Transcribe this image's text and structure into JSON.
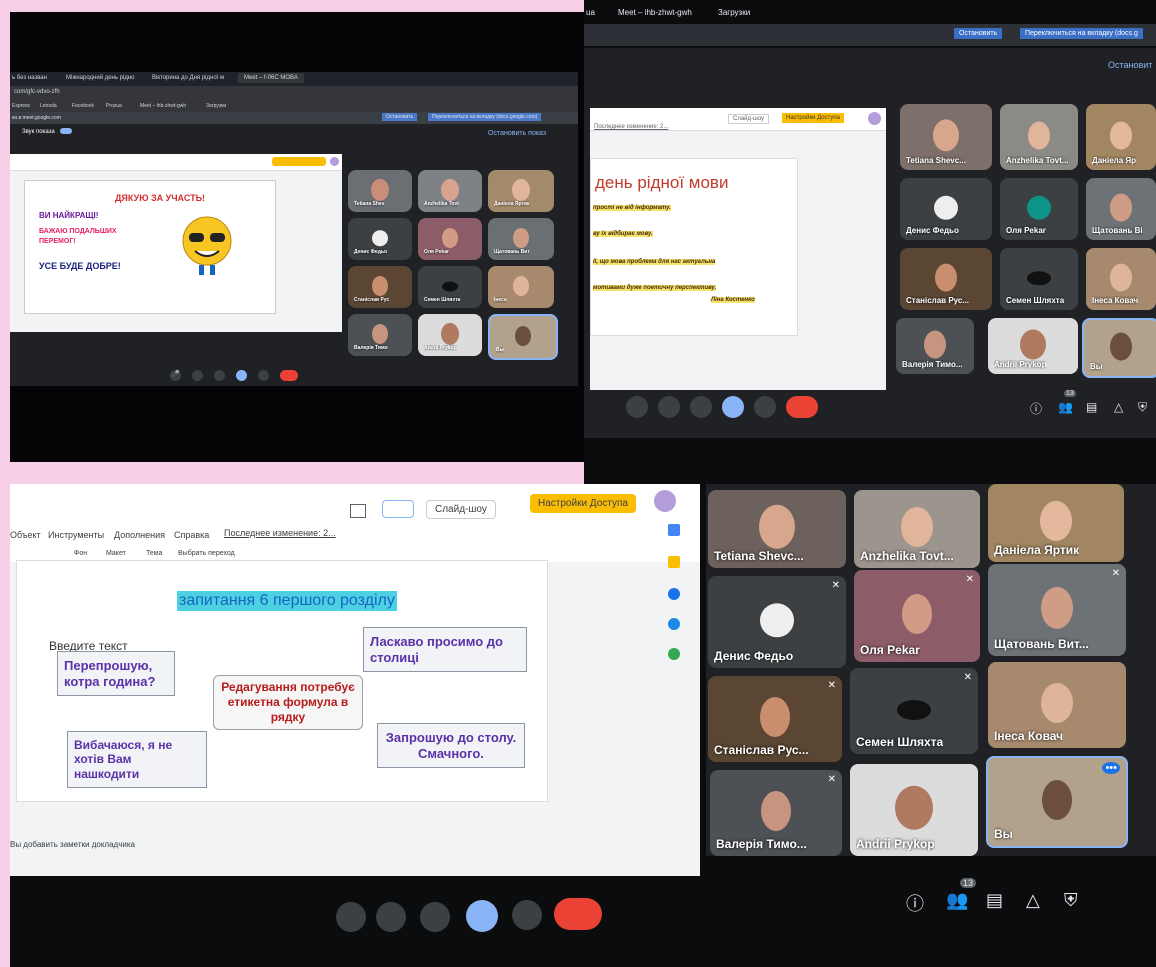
{
  "photo_tl": {
    "tabs": [
      "ь без назван",
      "Міжнародний день рідно",
      "Вікторина до Дня рідної м",
      "Meet – f-06C МОВА"
    ],
    "url": "com/gfc-vdvo-zfh",
    "bookmarks": [
      "Express",
      "Lenoda",
      "Facebook",
      "Prozua",
      "Meet – ihb-zhwt-gwh",
      "Загрузки"
    ],
    "toast": "ка в meet.google.com",
    "btn_stop": "Остановить",
    "btn_switch": "Переключиться на вкладку (docs.google.com)",
    "sound_label": "Звук показа",
    "stop_show": "Остановить показ",
    "slide_lines": {
      "thanks": "ДЯКУЮ ЗА УЧАСТЬ!",
      "best": "ВИ НАЙКРАЩІ!",
      "wish": "БАЖАЮ ПОДАЛЬШИХ ПЕРЕМОГ!",
      "ok": "УСЕ БУДЕ ДОБРЕ!"
    },
    "participants": [
      "Tetiana Shev",
      "Anzhelika Tovt",
      "Даніела Яртик",
      "Денис Федьо",
      "Оля Pekar",
      "Щатовань Вит",
      "Станіслав Рус",
      "Семен Шляхта",
      "Інеса",
      "Валерія Тимо",
      "Andrii Prykop",
      "Вы"
    ]
  },
  "photo_tr": {
    "url_part": "ua",
    "bookmarks": [
      "Meet – ihb-zhwt-gwh",
      "Загрузки"
    ],
    "btn_stop": "Остановить",
    "btn_switch": "Переключиться на вкладку (docs.g",
    "stop_show": "Остановит",
    "last_edit": "Последнее изменение: 2...",
    "present_btn": "Слайд-шоу",
    "access_btn": "Настройки Доступа",
    "slide_title": "день рідної  мови",
    "slide_lines": [
      "прості не від інформату.",
      "ву їх відбирає мову.",
      "ії, що мова проблема для нас актуальна",
      "мотивами дуже поетичну перспективу.",
      "Ліна Костенко"
    ],
    "participants": [
      "Tetiana Shevc...",
      "Anzhelika Tovt...",
      "Даніела Яр",
      "Денис Федьо",
      "Оля Pekar",
      "Щатовань Ві",
      "Станіслав Рус...",
      "Семен Шляхта",
      "Інеса Ковач",
      "Валерія Тимо...",
      "Andrii Prykop",
      "Вы"
    ],
    "people_count": "13"
  },
  "photo_bottom": {
    "menu": [
      "Объект",
      "Инструменты",
      "Дополнения",
      "Справка"
    ],
    "last_edit": "Последнее изменение: 2...",
    "toolbar": [
      "Фон",
      "Макет",
      "Тема",
      "Выбрать переход"
    ],
    "present_btn": "Слайд-шоу",
    "access_btn": "Настройки Доступа",
    "slide_title": "запитання 6 першого розділу",
    "placeholder": "Введите текст",
    "bubble_1": "Перепрошую, котра година?",
    "bubble_2": "Ласкаво просимо до столиці",
    "center_box": "Редагування потребує етикетна формула в рядку",
    "bubble_3": "Вибачаюся, я не хотів Вам нашкодити",
    "bubble_4": "Запрошую до столу. Смачного.",
    "notes": "Вы добавить заметки докладчика",
    "participants": [
      "Tetiana Shevc...",
      "Anzhelika Tovt...",
      "Даніела Яртик",
      "Денис Федьо",
      "Оля Pekar",
      "Щатовань Вит...",
      "Станіслав Рус...",
      "Семен Шляхта",
      "Інеса Ковач",
      "Валерія Тимо...",
      "Andrii Prykop",
      "Вы"
    ],
    "people_count": "13"
  },
  "colors": {
    "meet_dark": "#202124",
    "tile": "#3c4043",
    "hangup": "#ea4335",
    "present": "#8ab4f8",
    "access": "#fbbc04",
    "slide_title_bg": "#4dd0e1",
    "pink_frame": "#f7cfe6"
  },
  "icons": [
    "mic-icon",
    "camera-icon",
    "captions-icon",
    "present-icon",
    "more-icon",
    "hangup-icon",
    "info-icon",
    "people-icon",
    "chat-icon",
    "activities-icon",
    "shield-icon"
  ]
}
